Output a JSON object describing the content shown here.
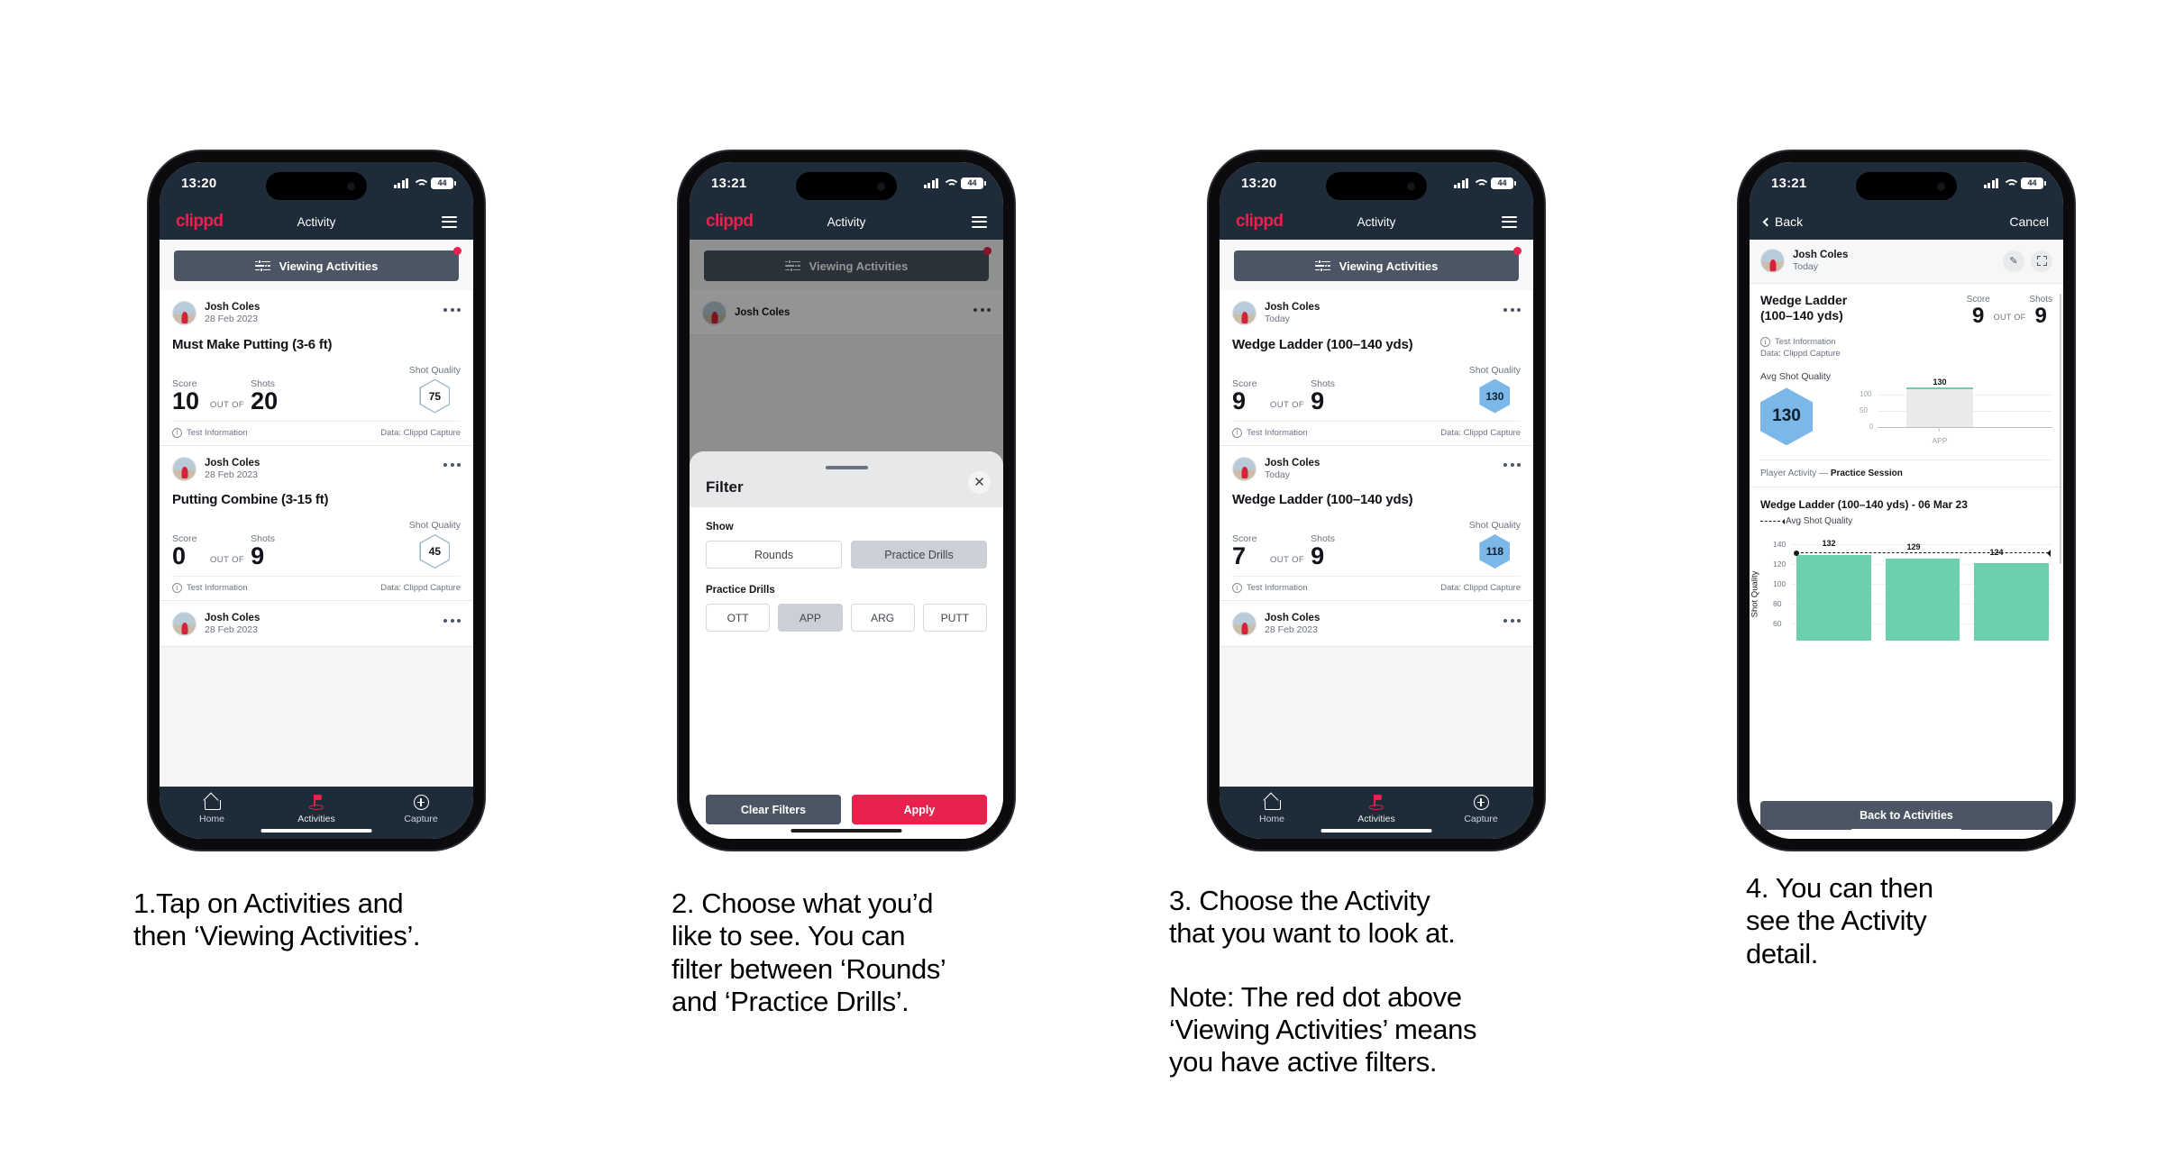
{
  "panels": [
    {
      "id": "panel-1",
      "status": {
        "time": "13:20",
        "battery": "44"
      },
      "appbar": {
        "brand": "clippd",
        "title": "Activity"
      },
      "filter_bar": {
        "label": "Viewing Activities",
        "has_red_dot": true
      },
      "cards": [
        {
          "user": "Josh Coles",
          "date": "28 Feb 2023",
          "title": "Must Make Putting (3-6 ft)",
          "score_label": "Score",
          "score": "10",
          "outof_label": "OUT OF",
          "shots_label": "Shots",
          "shots": "20",
          "sq_label": "Shot Quality",
          "sq": "75",
          "sq_style": "outline",
          "foot_left": "Test Information",
          "foot_right": "Data: Clippd Capture"
        },
        {
          "user": "Josh Coles",
          "date": "28 Feb 2023",
          "title": "Putting Combine (3-15 ft)",
          "score_label": "Score",
          "score": "0",
          "outof_label": "OUT OF",
          "shots_label": "Shots",
          "shots": "9",
          "sq_label": "Shot Quality",
          "sq": "45",
          "sq_style": "outline",
          "foot_left": "Test Information",
          "foot_right": "Data: Clippd Capture"
        },
        {
          "user": "Josh Coles",
          "date": "28 Feb 2023",
          "title": "",
          "partial": true
        }
      ],
      "tabs": [
        {
          "label": "Home",
          "icon": "home-icon",
          "active": false
        },
        {
          "label": "Activities",
          "icon": "golf-flag-icon",
          "active": true
        },
        {
          "label": "Capture",
          "icon": "plus-circle-icon",
          "active": false
        }
      ]
    },
    {
      "id": "panel-2",
      "status": {
        "time": "13:21",
        "battery": "44"
      },
      "appbar": {
        "brand": "clippd",
        "title": "Activity"
      },
      "filter_bar": {
        "label": "Viewing Activities",
        "has_red_dot": true
      },
      "card_peek": {
        "user": "Josh Coles"
      },
      "sheet": {
        "title": "Filter",
        "close_icon": "close-icon",
        "show_label": "Show",
        "show_options": [
          {
            "label": "Rounds",
            "selected": false
          },
          {
            "label": "Practice Drills",
            "selected": true
          }
        ],
        "drills_label": "Practice Drills",
        "drill_options": [
          {
            "label": "OTT",
            "selected": false
          },
          {
            "label": "APP",
            "selected": true
          },
          {
            "label": "ARG",
            "selected": false
          },
          {
            "label": "PUTT",
            "selected": false
          }
        ],
        "clear_label": "Clear Filters",
        "apply_label": "Apply"
      }
    },
    {
      "id": "panel-3",
      "status": {
        "time": "13:20",
        "battery": "44"
      },
      "appbar": {
        "brand": "clippd",
        "title": "Activity"
      },
      "filter_bar": {
        "label": "Viewing Activities",
        "has_red_dot": true
      },
      "cards": [
        {
          "user": "Josh Coles",
          "date": "Today",
          "title": "Wedge Ladder (100–140 yds)",
          "score_label": "Score",
          "score": "9",
          "outof_label": "OUT OF",
          "shots_label": "Shots",
          "shots": "9",
          "sq_label": "Shot Quality",
          "sq": "130",
          "sq_style": "fill",
          "foot_left": "Test Information",
          "foot_right": "Data: Clippd Capture"
        },
        {
          "user": "Josh Coles",
          "date": "Today",
          "title": "Wedge Ladder (100–140 yds)",
          "score_label": "Score",
          "score": "7",
          "outof_label": "OUT OF",
          "shots_label": "Shots",
          "shots": "9",
          "sq_label": "Shot Quality",
          "sq": "118",
          "sq_style": "fill",
          "foot_left": "Test Information",
          "foot_right": "Data: Clippd Capture"
        },
        {
          "user": "Josh Coles",
          "date": "28 Feb 2023",
          "title": "",
          "partial": true
        }
      ],
      "tabs": [
        {
          "label": "Home",
          "icon": "home-icon",
          "active": false
        },
        {
          "label": "Activities",
          "icon": "golf-flag-icon",
          "active": true
        },
        {
          "label": "Capture",
          "icon": "plus-circle-icon",
          "active": false
        }
      ]
    },
    {
      "id": "panel-4",
      "status": {
        "time": "13:21",
        "battery": "44"
      },
      "navbar": {
        "back": "Back",
        "cancel": "Cancel"
      },
      "detail": {
        "user": "Josh Coles",
        "date": "Today",
        "edit_icon": "pencil-icon",
        "expand_icon": "expand-icon",
        "title": "Wedge Ladder (100–140 yds)",
        "score_label": "Score",
        "score": "9",
        "outof_label": "OUT OF",
        "shots_label": "Shots",
        "shots": "9",
        "test_info": "Test Information",
        "data_source": "Data: Clippd Capture",
        "avg_sq_label": "Avg Shot Quality",
        "avg_sq": "130",
        "session_prefix": "Player Activity —",
        "session_name": "Practice Session",
        "chart_title": "Wedge Ladder (100–140 yds) - 06 Mar 23",
        "legend": "Avg Shot Quality",
        "cta": "Back to Activities"
      }
    }
  ],
  "chart_data": [
    {
      "type": "bar",
      "title": "Avg Shot Quality",
      "categories": [
        "APP"
      ],
      "values": [
        130
      ],
      "labels": [
        "130"
      ],
      "ylabel": "",
      "yticks": [
        0,
        50,
        100
      ],
      "ylim": [
        0,
        140
      ],
      "grid": true
    },
    {
      "type": "bar",
      "title": "Wedge Ladder (100–140 yds) - 06 Mar 23",
      "categories": [
        "1",
        "2",
        "3"
      ],
      "values": [
        132,
        129,
        124
      ],
      "labels": [
        "132",
        "129",
        "124"
      ],
      "xlabel": "",
      "ylabel": "Shot Quality",
      "yticks": [
        60,
        80,
        100,
        120,
        140
      ],
      "ylim": [
        50,
        145
      ],
      "grid": true,
      "legend": "Avg Shot Quality",
      "legend_position": "top-left",
      "annotations": [
        {
          "type": "avg-line",
          "label": "Avg Shot Quality",
          "value": 132
        }
      ]
    }
  ],
  "captions": [
    {
      "lines": [
        "1.Tap on Activities and",
        "then ‘Viewing Activities’."
      ]
    },
    {
      "lines": [
        "2. Choose what you’d",
        "like to see. You can",
        "filter between ‘Rounds’",
        "and ‘Practice Drills’."
      ]
    },
    {
      "lines": [
        "3. Choose the Activity",
        "that you want to look at."
      ],
      "note_lines": [
        "Note: The red dot above",
        "‘Viewing Activities’ means",
        "you have active filters."
      ]
    },
    {
      "lines": [
        "4. You can then",
        "see the Activity",
        "detail."
      ]
    }
  ]
}
